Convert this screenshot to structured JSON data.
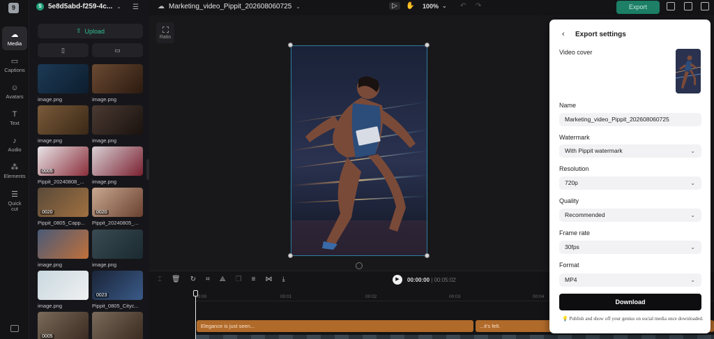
{
  "rail": {
    "logo": "9",
    "items": [
      {
        "label": "Media",
        "icon": "cloud-icon"
      },
      {
        "label": "Captions",
        "icon": "captions-icon"
      },
      {
        "label": "Avatars",
        "icon": "avatar-icon"
      },
      {
        "label": "Text",
        "icon": "text-icon"
      },
      {
        "label": "Audio",
        "icon": "audio-icon"
      },
      {
        "label": "Elements",
        "icon": "elements-icon"
      },
      {
        "label": "Quick cut",
        "icon": "quick-cut-icon"
      }
    ]
  },
  "project": {
    "name": "5e8d5abd-f259-4c...",
    "badge": "S"
  },
  "media": {
    "upload_label": "Upload",
    "tabs": [
      "phone-icon",
      "desktop-icon"
    ],
    "items": [
      {
        "label": "image.png",
        "duration": "",
        "colors": [
          "#1c3a55",
          "#0d1d2e"
        ]
      },
      {
        "label": "image.png",
        "duration": "",
        "colors": [
          "#6b4a32",
          "#2b1a10"
        ]
      },
      {
        "label": "image.png",
        "duration": "",
        "colors": [
          "#7a5a3a",
          "#3a2816"
        ]
      },
      {
        "label": "image.png",
        "duration": "",
        "colors": [
          "#4a3a32",
          "#1a120e"
        ]
      },
      {
        "label": "Pippit_20240808_...",
        "duration": "0005",
        "colors": [
          "#e8e4e8",
          "#8a2e3a"
        ]
      },
      {
        "label": "image.png",
        "duration": "",
        "colors": [
          "#d8d0d4",
          "#7a2030"
        ]
      },
      {
        "label": "Pippit_0805_Capp...",
        "duration": "0020",
        "colors": [
          "#5a4a3a",
          "#a07040"
        ]
      },
      {
        "label": "Pippit_20240805_...",
        "duration": "0020",
        "colors": [
          "#c8a890",
          "#6a4030"
        ]
      },
      {
        "label": "image.png",
        "duration": "",
        "colors": [
          "#4a5a78",
          "#c0703a"
        ]
      },
      {
        "label": "image.png",
        "duration": "",
        "colors": [
          "#3a4a52",
          "#1a2a30"
        ]
      },
      {
        "label": "image.png",
        "duration": "",
        "colors": [
          "#c8d8e0",
          "#f0f0f0"
        ]
      },
      {
        "label": "Pippit_0805_Cityc...",
        "duration": "0023",
        "colors": [
          "#1a2438",
          "#3a5a88"
        ]
      },
      {
        "label": "",
        "duration": "0005",
        "colors": [
          "#7a6a5a",
          "#3a2a20"
        ]
      },
      {
        "label": "",
        "duration": "",
        "colors": [
          "#7a6a5a",
          "#3a2a20"
        ]
      }
    ]
  },
  "topbar": {
    "filename": "Marketing_video_Pippit_202608060725",
    "zoom": "100%",
    "export_label": "Export"
  },
  "canvas": {
    "ratio_label": "Ratio"
  },
  "timeline": {
    "current": "00:00:00",
    "separator": "|",
    "total": "00:05:02",
    "ticks": [
      "00:00",
      "00:01",
      "00:02",
      "00:03",
      "00:04"
    ],
    "tracks": [
      {
        "label": "Elegance is just seen..."
      },
      {
        "label": "...it's felt."
      }
    ]
  },
  "export_panel": {
    "title": "Export settings",
    "video_cover_label": "Video cover",
    "name_label": "Name",
    "name_value": "Marketing_video_Pippit_202608060725",
    "watermark_label": "Watermark",
    "watermark_value": "With Pippit watermark",
    "resolution_label": "Resolution",
    "resolution_value": "720p",
    "quality_label": "Quality",
    "quality_value": "Recommended",
    "frame_rate_label": "Frame rate",
    "frame_rate_value": "30fps",
    "format_label": "Format",
    "format_value": "MP4",
    "download_label": "Download",
    "tip": "Publish and show off your genius on social media once downloaded."
  }
}
